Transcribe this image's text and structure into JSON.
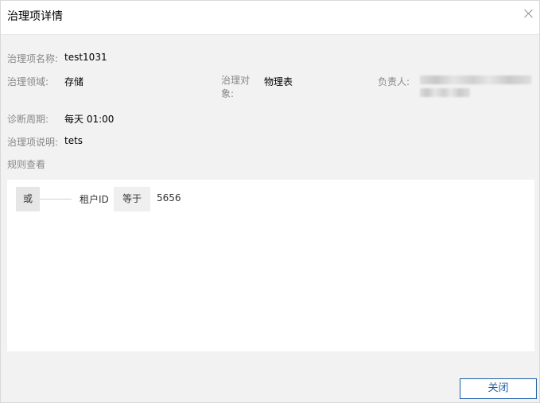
{
  "dialog": {
    "title": "治理项详情",
    "close_button": "关闭"
  },
  "details": {
    "name_label": "治理项名称:",
    "name_value": "test1031",
    "domain_label": "治理领域:",
    "domain_value": "存储",
    "object_label": "治理对象:",
    "object_value": "物理表",
    "owner_label": "负责人:",
    "period_label": "诊断周期:",
    "period_value": "每天 01:00",
    "desc_label": "治理项说明:",
    "desc_value": "tets"
  },
  "rules": {
    "section_label": "规则查看",
    "logic_operator": "或",
    "field": "租户ID",
    "operator": "等于",
    "value": "5656"
  }
}
